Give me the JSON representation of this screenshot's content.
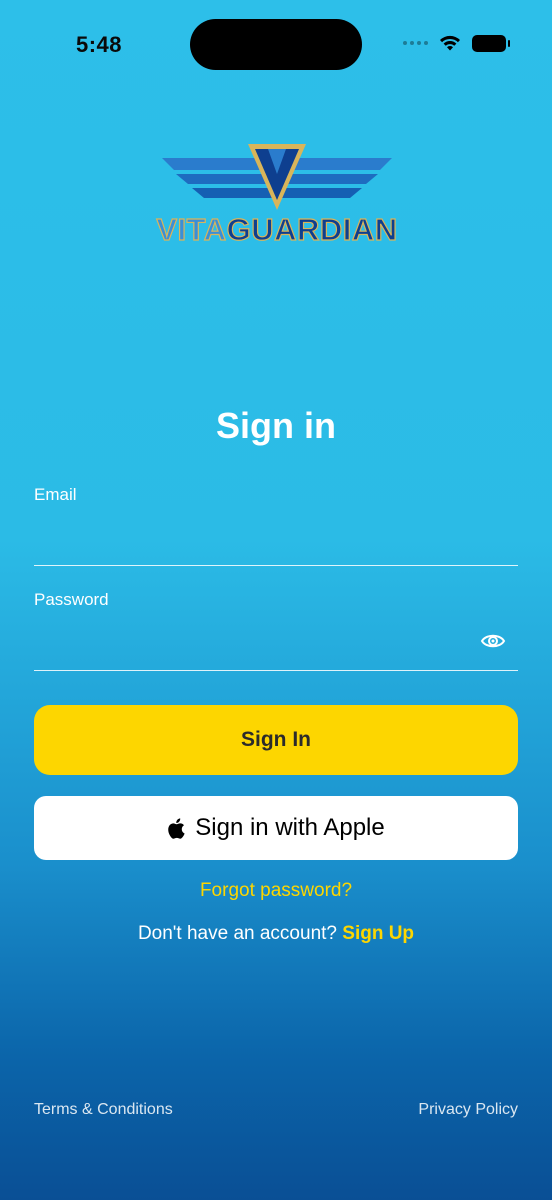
{
  "status_bar": {
    "time": "5:48"
  },
  "logo": {
    "part1": "VITA",
    "part2": "GUARDIAN"
  },
  "page": {
    "title": "Sign in"
  },
  "form": {
    "email_label": "Email",
    "email_value": "",
    "password_label": "Password",
    "password_value": ""
  },
  "buttons": {
    "sign_in": "Sign In",
    "apple": "Sign in with Apple"
  },
  "links": {
    "forgot": "Forgot password?",
    "no_account": "Don't have an account?",
    "sign_up": "Sign Up"
  },
  "footer": {
    "terms": "Terms & Conditions",
    "privacy": "Privacy Policy"
  },
  "colors": {
    "accent": "#fdd600",
    "background_top": "#2dbfe9",
    "background_bottom": "#0a4f95"
  },
  "icons": [
    "signal-icon",
    "wifi-icon",
    "battery-icon",
    "eye-icon",
    "apple-icon"
  ]
}
